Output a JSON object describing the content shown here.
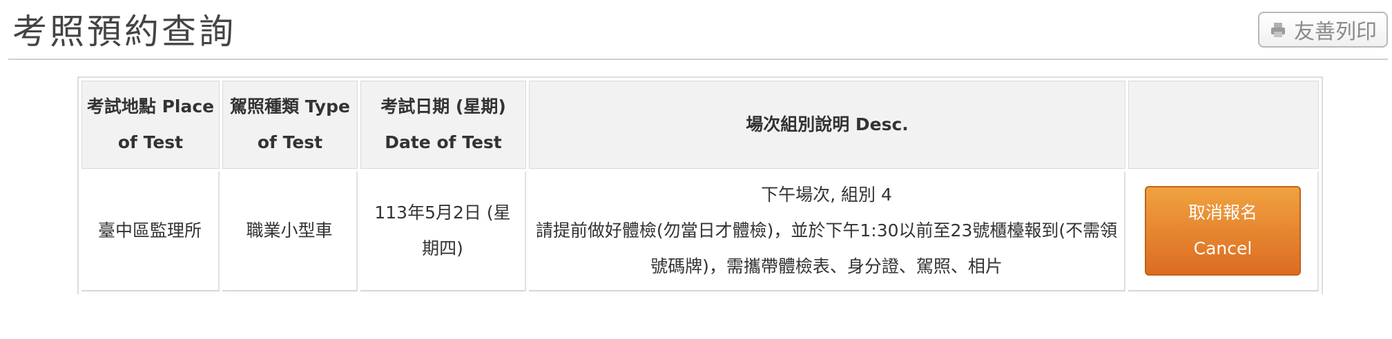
{
  "page": {
    "title": "考照預約查詢",
    "print_button_label": "友善列印"
  },
  "table": {
    "headers": {
      "place": "考試地點 Place of Test",
      "type": "駕照種類 Type of Test",
      "date": "考試日期 (星期) Date of Test",
      "desc": "場次組別說明 Desc.",
      "action": ""
    },
    "rows": [
      {
        "place": "臺中區監理所",
        "type": "職業小型車",
        "date": "113年5月2日 (星期四)",
        "desc_line1": "下午場次, 組別 4",
        "desc_line2": "請提前做好體檢(勿當日才體檢)，並於下午1:30以前至23號櫃檯報到(不需領號碼牌)，需攜帶體檢表、身分證、駕照、相片",
        "cancel_label_zh": "取消報名",
        "cancel_label_en": "Cancel"
      }
    ]
  },
  "icons": {
    "print": "printer-icon"
  },
  "colors": {
    "cancel_button_top": "#f0a23f",
    "cancel_button_bottom": "#dc6c22",
    "header_cell_bg": "#f2f2f2"
  }
}
